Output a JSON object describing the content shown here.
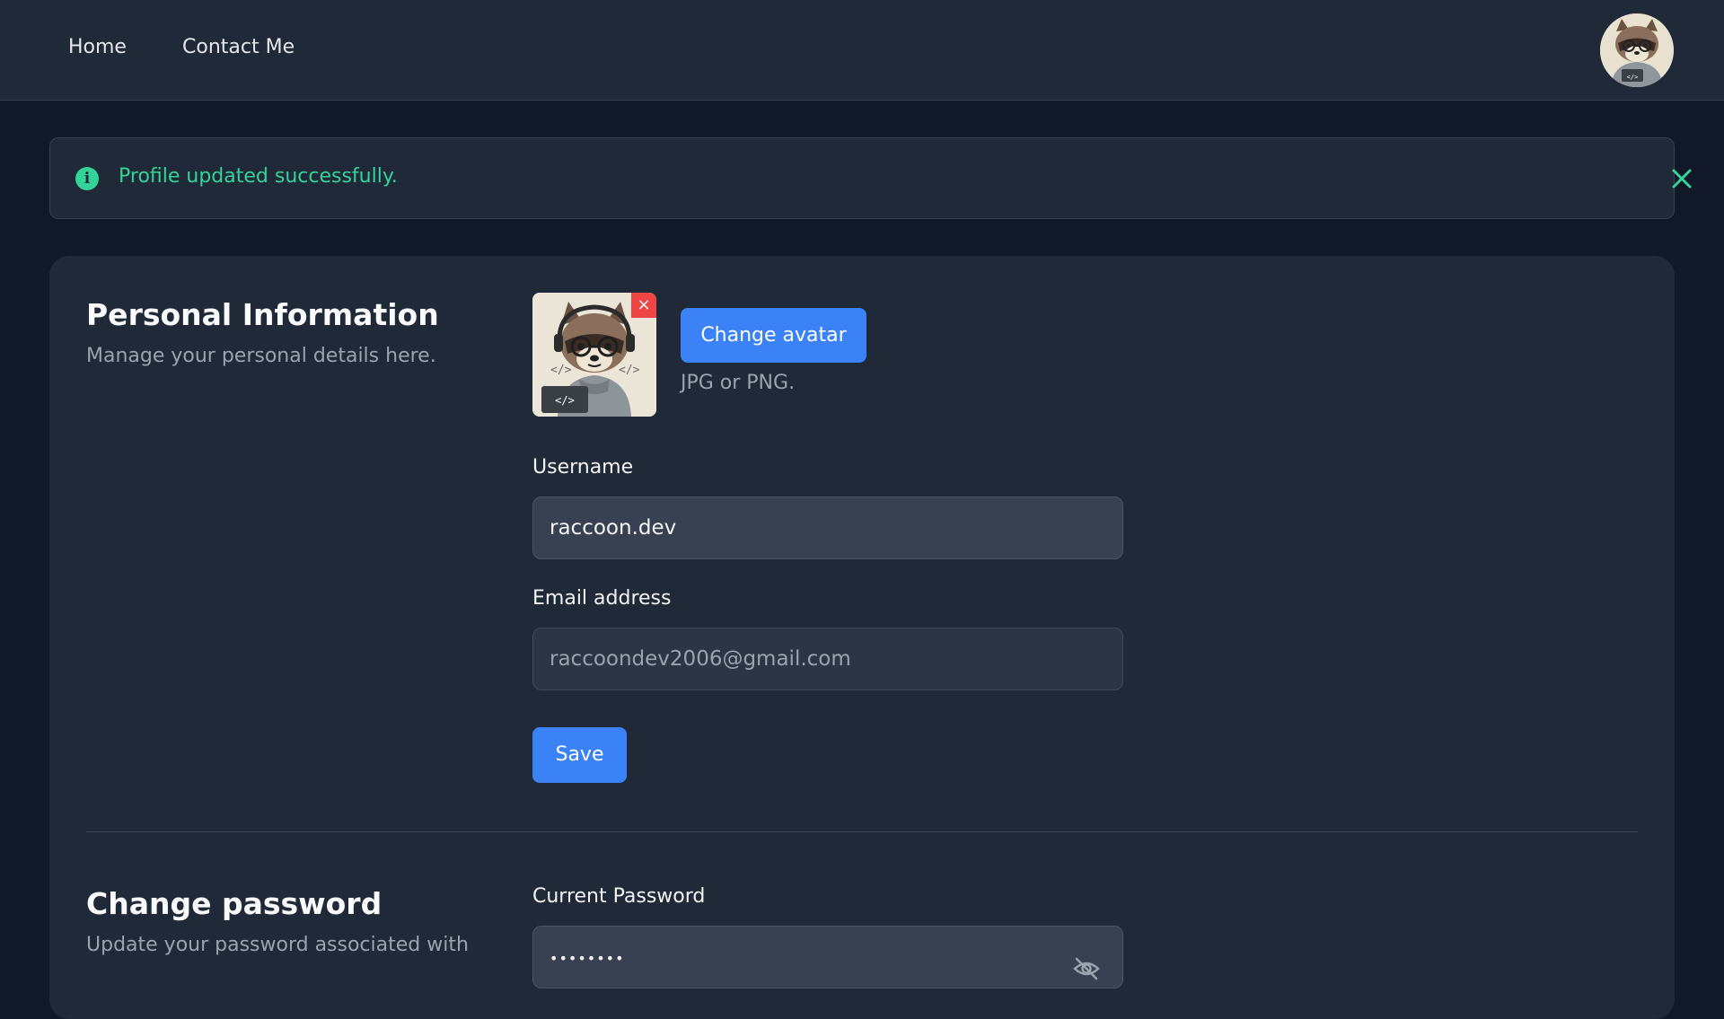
{
  "nav": {
    "links": [
      {
        "label": "Home"
      },
      {
        "label": "Contact Me"
      }
    ],
    "avatar_icon": "raccoon-avatar-icon"
  },
  "alert": {
    "message": "Profile updated successfully.",
    "icon": "info-icon",
    "close_icon": "close-icon",
    "color": "#34d399"
  },
  "personal": {
    "title": "Personal Information",
    "description": "Manage your personal details here.",
    "avatar": {
      "remove_icon": "×",
      "change_label": "Change avatar",
      "hint": "JPG or PNG."
    },
    "username": {
      "label": "Username",
      "value": "raccoon.dev"
    },
    "email": {
      "label": "Email address",
      "value": "raccoondev2006@gmail.com"
    },
    "save_label": "Save"
  },
  "password": {
    "title": "Change password",
    "description": "Update your password associated with",
    "current": {
      "label": "Current Password",
      "value": "••••••••",
      "toggle_icon": "eye-off-icon"
    }
  },
  "colors": {
    "page_bg": "#111827",
    "card_bg": "#1f2937",
    "accent": "#3b82f6",
    "danger": "#ef4444"
  }
}
